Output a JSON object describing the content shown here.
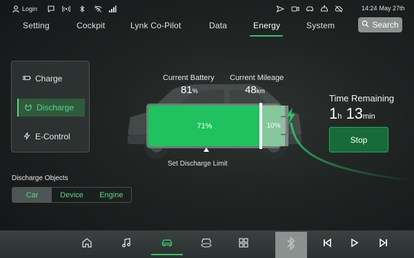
{
  "status_bar": {
    "login_label": "Login",
    "time": "14:24",
    "date": "May 27th",
    "icons": [
      "user-icon",
      "message-icon",
      "hotspot-icon",
      "bluetooth-icon",
      "wifi-off-icon",
      "signal-icon",
      "navigation-icon",
      "camera-icon",
      "car-icon",
      "car-settings-icon",
      "cloud-off-icon"
    ]
  },
  "nav": {
    "tabs": [
      {
        "label": "Setting"
      },
      {
        "label": "Cockpit"
      },
      {
        "label": "Lynk Co-Pilot"
      },
      {
        "label": "Data"
      },
      {
        "label": "Energy"
      },
      {
        "label": "System"
      }
    ],
    "active_tab": "Energy",
    "search_label": "Search"
  },
  "mode_panel": {
    "items": [
      {
        "label": "Charge",
        "icon": "battery-icon"
      },
      {
        "label": "Discharge",
        "icon": "plug-icon"
      },
      {
        "label": "E-Control",
        "icon": "lightning-icon"
      }
    ],
    "active": "Discharge"
  },
  "discharge_objects": {
    "title": "Discharge Objects",
    "options": [
      "Car",
      "Device",
      "Engine"
    ],
    "selected": "Car"
  },
  "battery": {
    "current_battery_label": "Current Battery",
    "current_battery_value": "81",
    "current_battery_unit": "%",
    "current_mileage_label": "Current Mileage",
    "current_mileage_value": "48",
    "current_mileage_unit": "km",
    "available_percent_label": "71%",
    "limit_percent_label": "10%",
    "available_fraction": 0.71,
    "limit_fraction": 0.1,
    "set_limit_label": "Set Discharge Limit"
  },
  "time_remaining": {
    "title": "Time Remaining",
    "hours": "1",
    "hours_unit": "h",
    "minutes": "13",
    "minutes_unit": "min",
    "stop_label": "Stop"
  },
  "dock": {
    "items": [
      "home-icon",
      "music-icon",
      "car-icon",
      "360-camera-icon",
      "apps-grid-icon"
    ],
    "active": "car-icon",
    "media": [
      "bluetooth-icon",
      "previous-icon",
      "play-icon",
      "next-icon"
    ]
  },
  "colors": {
    "accent": "#35c46a",
    "battery_fill": "#1fc25f",
    "stop_button": "#166b38"
  }
}
